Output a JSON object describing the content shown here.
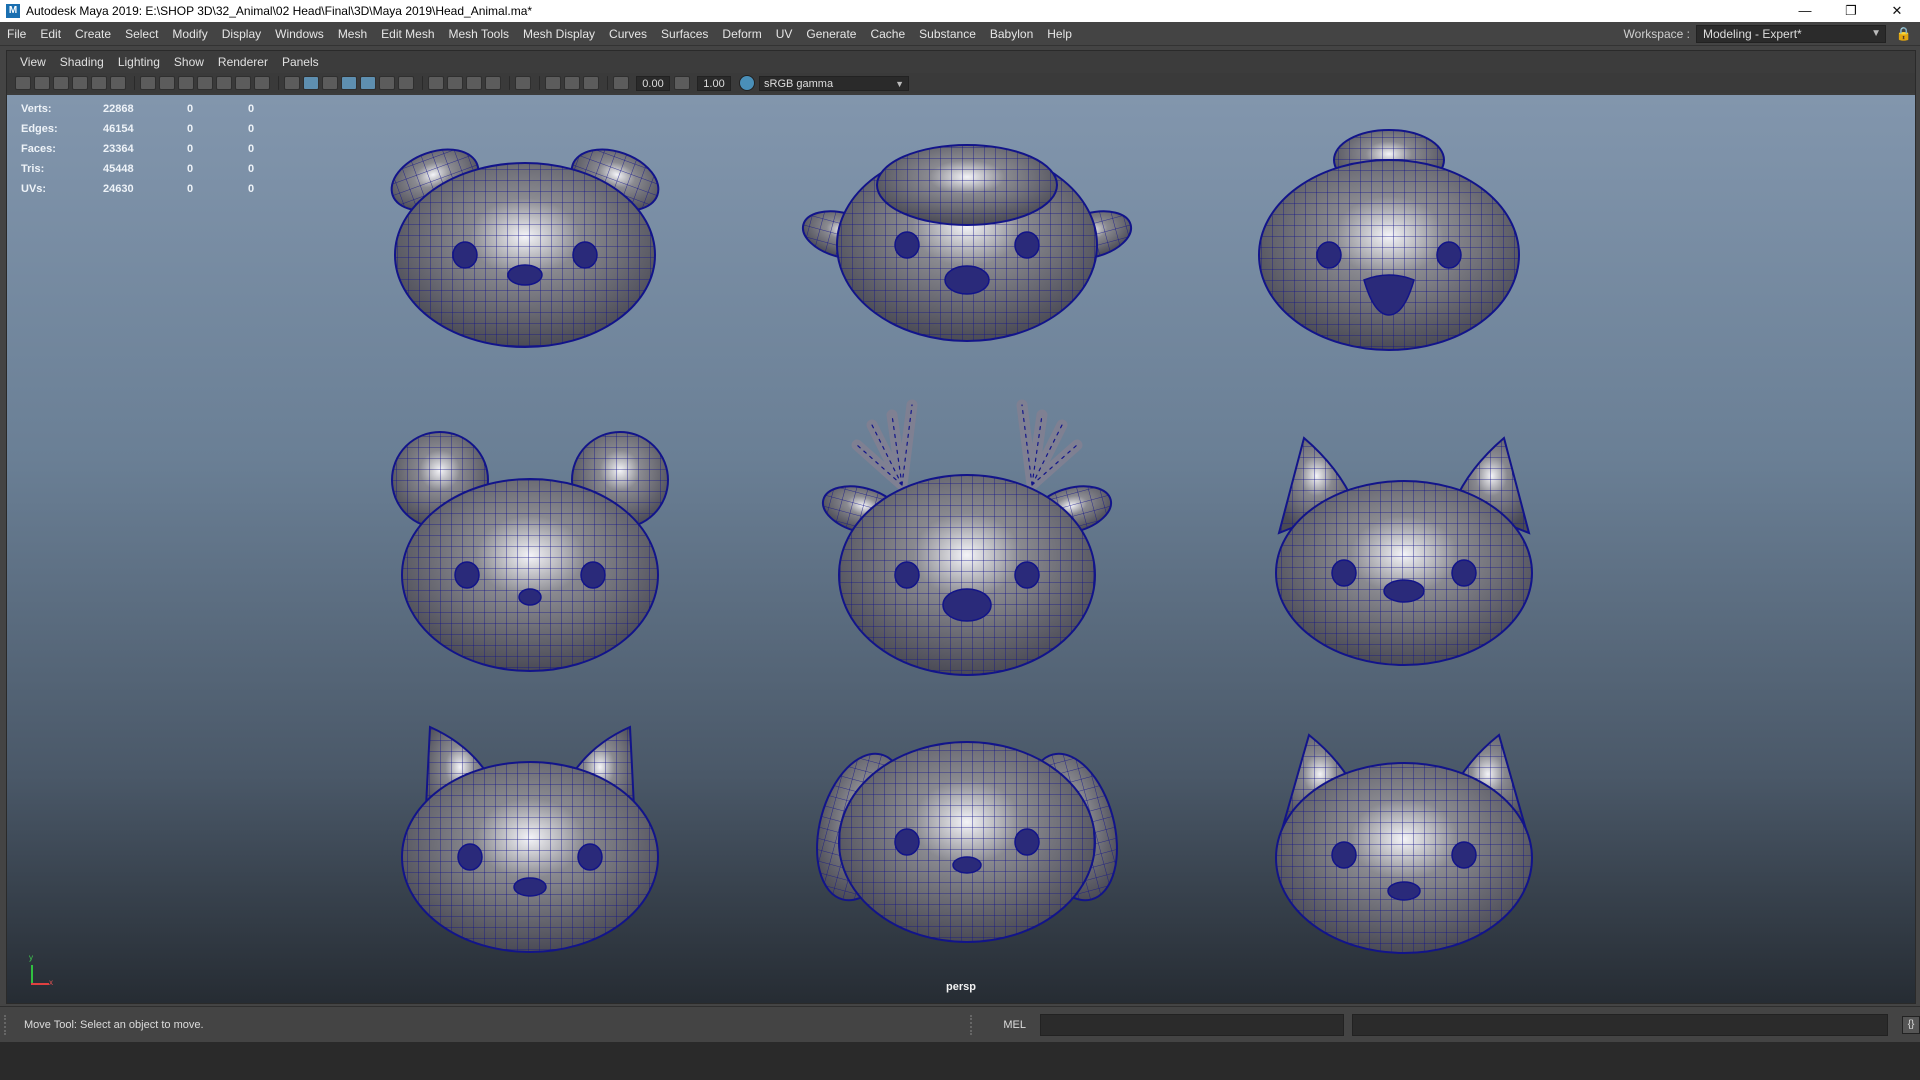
{
  "window": {
    "title": "Autodesk Maya 2019: E:\\SHOP 3D\\32_Animal\\02 Head\\Final\\3D\\Maya 2019\\Head_Animal.ma*",
    "app_icon": "M",
    "minimize_glyph": "—",
    "restore_glyph": "❐",
    "close_glyph": "✕"
  },
  "menubar": {
    "items": [
      "File",
      "Edit",
      "Create",
      "Select",
      "Modify",
      "Display",
      "Windows",
      "Mesh",
      "Edit Mesh",
      "Mesh Tools",
      "Mesh Display",
      "Curves",
      "Surfaces",
      "Deform",
      "UV",
      "Generate",
      "Cache",
      "Substance",
      "Babylon",
      "Help"
    ],
    "workspace_label": "Workspace :",
    "workspace_value": "Modeling - Expert*",
    "lock_glyph": "🔒"
  },
  "panel_menu": {
    "items": [
      "View",
      "Shading",
      "Lighting",
      "Show",
      "Renderer",
      "Panels"
    ]
  },
  "panel_toolbar": {
    "value_a": "0.00",
    "value_b": "1.00",
    "color_space": "sRGB gamma",
    "dropdown_glyph": "▼"
  },
  "hud": {
    "rows": [
      {
        "label": "Verts:",
        "v1": "22868",
        "v2": "0",
        "v3": "0"
      },
      {
        "label": "Edges:",
        "v1": "46154",
        "v2": "0",
        "v3": "0"
      },
      {
        "label": "Faces:",
        "v1": "23364",
        "v2": "0",
        "v3": "0"
      },
      {
        "label": "Tris:",
        "v1": "45448",
        "v2": "0",
        "v3": "0"
      },
      {
        "label": "UVs:",
        "v1": "24630",
        "v2": "0",
        "v3": "0"
      }
    ]
  },
  "viewport": {
    "camera_label": "persp",
    "axis_x": "x",
    "axis_y": "y",
    "mesh_color": "#8a8a90",
    "wire_color": "#12148a",
    "heads": [
      "dog",
      "sheep",
      "chick",
      "bear",
      "deer",
      "cat",
      "fox",
      "puppy",
      "kitten"
    ]
  },
  "status": {
    "help_line": "Move Tool: Select an object to move.",
    "command_language": "MEL",
    "script_editor_glyph": "{}"
  }
}
